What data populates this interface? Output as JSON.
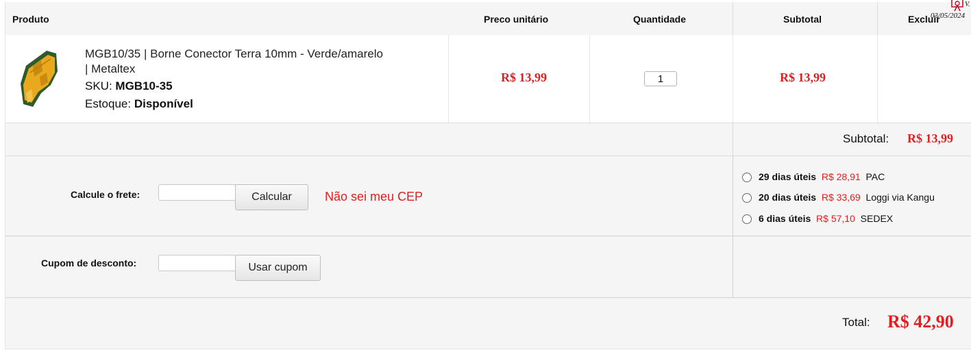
{
  "header": {
    "product": "Produto",
    "unit_price": "Preco unitário",
    "quantity": "Quantidade",
    "subtotal": "Subtotal",
    "delete": "Excluir"
  },
  "stamp": {
    "line1": "V.",
    "line2": "03/05/2024"
  },
  "item": {
    "name_line1": "MGB10/35 | Borne Conector Terra 10mm - Verde/amarelo",
    "name_line2": "| Metaltex",
    "sku_label": "SKU:",
    "sku": "MGB10-35",
    "stock_label": "Estoque:",
    "stock": "Disponível",
    "unit_price": "R$ 13,99",
    "quantity": "1",
    "subtotal": "R$ 13,99"
  },
  "summary": {
    "subtotal_label": "Subtotal:",
    "subtotal_value": "R$ 13,99",
    "total_label": "Total:",
    "total_value": "R$ 42,90"
  },
  "shipping": {
    "label": "Calcule o frete:",
    "cep_value": "",
    "calc_button": "Calcular",
    "unknown_cep_link": "Não sei meu CEP",
    "options": [
      {
        "days": "29 dias úteis",
        "price": "R$ 28,91",
        "carrier": "PAC"
      },
      {
        "days": "20 dias úteis",
        "price": "R$ 33,69",
        "carrier": "Loggi via Kangu"
      },
      {
        "days": "6 dias úteis",
        "price": "R$ 57,10",
        "carrier": "SEDEX"
      }
    ]
  },
  "coupon": {
    "label": "Cupom de desconto:",
    "code_value": "",
    "apply_button": "Usar cupom"
  },
  "colors": {
    "price_red": "#e02020",
    "header_bg": "#f5f5f5",
    "product_terminal": "#f0b020"
  }
}
